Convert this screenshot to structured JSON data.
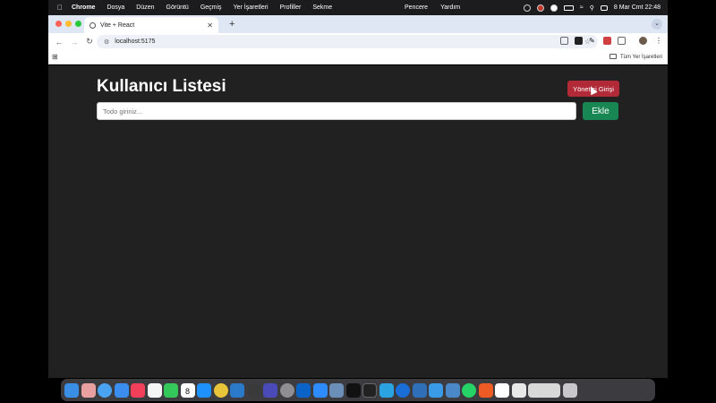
{
  "menubar": {
    "app_name": "Chrome",
    "items": [
      "Dosya",
      "Düzen",
      "Görüntü",
      "Geçmiş",
      "Yer İşaretleri",
      "Profiller",
      "Sekme"
    ],
    "middle_items": [
      "Pencere",
      "Yardım"
    ],
    "clock": "8 Mar Cmt  22:48"
  },
  "browser": {
    "tab_title": "Vite + React",
    "url": "localhost:5175",
    "bookmarks_all": "Tüm Yer İşaretleri"
  },
  "page": {
    "title": "Kullanıcı Listesi",
    "admin_button": "Yönetici Girişi",
    "input_placeholder": "Todo giriniz...",
    "add_button": "Ekle"
  },
  "colors": {
    "page_bg": "#212121",
    "admin_btn": "#b02a37",
    "add_btn": "#198754"
  },
  "dock": {
    "icons": [
      "finder-icon",
      "launchpad-icon",
      "safari-icon",
      "mail-icon",
      "music-icon",
      "photos-icon",
      "facetime-icon",
      "calendar-icon",
      "app-store-icon",
      "chrome-icon",
      "vscode-icon",
      "quicktime-icon",
      "imovie-icon",
      "system-settings-icon",
      "outlook-icon",
      "zoom-icon",
      "preview-icon",
      "github-icon",
      "terminal-icon",
      "telegram-icon",
      "quickplay-icon",
      "xcode-icon",
      "testflight-icon",
      "simulator-icon",
      "whatsapp-icon",
      "postman-icon",
      "slack-icon",
      "notes-icon",
      "screenshot-icon",
      "trash-icon"
    ],
    "calendar_day": "8"
  }
}
